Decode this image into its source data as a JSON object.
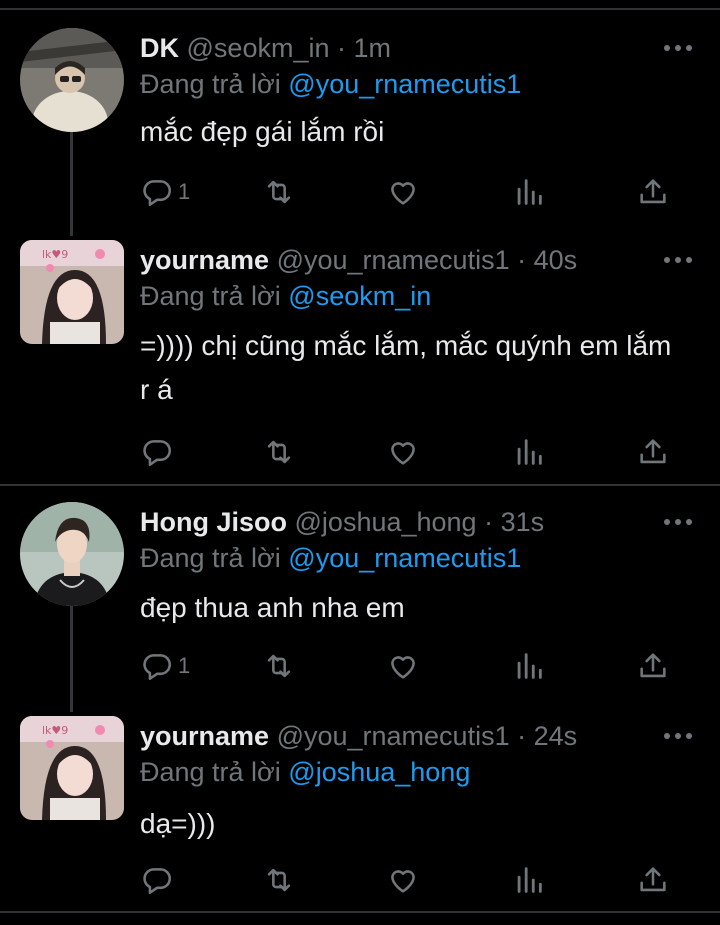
{
  "tweets": [
    {
      "name": "DK",
      "handle": "@seokm_in",
      "time": "1m",
      "reply_prefix": "Đang trả lời",
      "reply_to": "@you_rnamecutis1",
      "text": "mắc đẹp gái lắm rồi",
      "reply_count": "1"
    },
    {
      "name": "yourname",
      "handle": "@you_rnamecutis1",
      "time": "40s",
      "reply_prefix": "Đang trả lời",
      "reply_to": "@seokm_in",
      "text": "=)))) chị cũng mắc lắm, mắc quýnh em lắm r á",
      "reply_count": ""
    },
    {
      "name": "Hong Jisoo",
      "handle": "@joshua_hong",
      "time": "31s",
      "reply_prefix": "Đang trả lời",
      "reply_to": "@you_rnamecutis1",
      "text": "đẹp thua anh nha em",
      "reply_count": "1"
    },
    {
      "name": "yourname",
      "handle": "@you_rnamecutis1",
      "time": "24s",
      "reply_prefix": "Đang trả lời",
      "reply_to": "@joshua_hong",
      "text": "dạ=)))",
      "reply_count": ""
    }
  ],
  "separator": "·",
  "icons": [
    "reply-icon",
    "retweet-icon",
    "like-icon",
    "views-icon",
    "share-icon",
    "more-icon"
  ],
  "colors": {
    "background": "#000000",
    "text": "#e7e9ea",
    "muted": "#71767b",
    "link": "#1d9bf0",
    "divider": "#2f3336"
  }
}
